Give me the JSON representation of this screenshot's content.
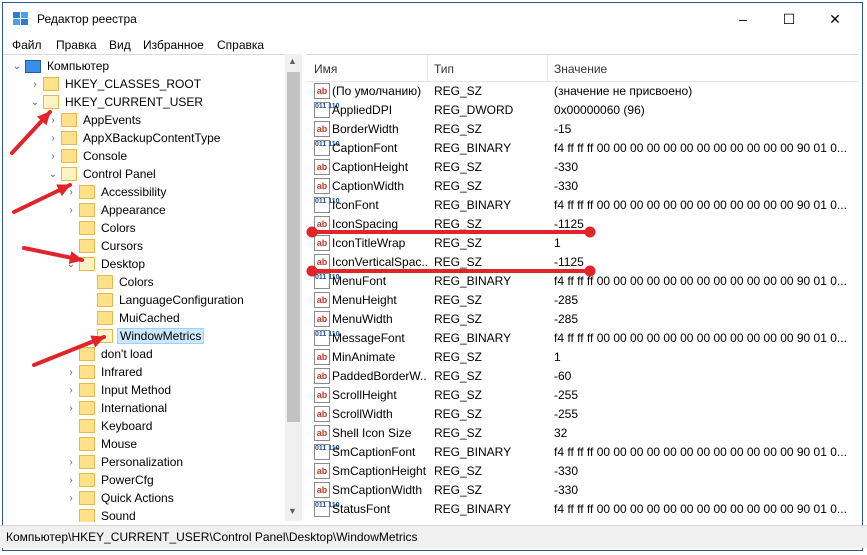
{
  "window": {
    "title": "Редактор реестра",
    "min": "–",
    "max": "☐",
    "close": "✕"
  },
  "menu": [
    "Файл",
    "Правка",
    "Вид",
    "Избранное",
    "Справка"
  ],
  "tree": [
    {
      "label": "Компьютер",
      "chev": "v",
      "level": 0,
      "kind": "computer"
    },
    {
      "label": "HKEY_CLASSES_ROOT",
      "chev": ">",
      "level": 1
    },
    {
      "label": "HKEY_CURRENT_USER",
      "chev": "v",
      "level": 1
    },
    {
      "label": "AppEvents",
      "chev": ">",
      "level": 2
    },
    {
      "label": "AppXBackupContentType",
      "chev": ">",
      "level": 2
    },
    {
      "label": "Console",
      "chev": ">",
      "level": 2
    },
    {
      "label": "Control Panel",
      "chev": "v",
      "level": 2
    },
    {
      "label": "Accessibility",
      "chev": ">",
      "level": 3
    },
    {
      "label": "Appearance",
      "chev": ">",
      "level": 3
    },
    {
      "label": "Colors",
      "chev": "",
      "level": 3
    },
    {
      "label": "Cursors",
      "chev": "",
      "level": 3
    },
    {
      "label": "Desktop",
      "chev": "v",
      "level": 3
    },
    {
      "label": "Colors",
      "chev": "",
      "level": 4
    },
    {
      "label": "LanguageConfiguration",
      "chev": "",
      "level": 4
    },
    {
      "label": "MuiCached",
      "chev": "",
      "level": 4
    },
    {
      "label": "WindowMetrics",
      "chev": "",
      "level": 4,
      "selected": true
    },
    {
      "label": "don't load",
      "chev": "",
      "level": 3
    },
    {
      "label": "Infrared",
      "chev": ">",
      "level": 3
    },
    {
      "label": "Input Method",
      "chev": ">",
      "level": 3
    },
    {
      "label": "International",
      "chev": ">",
      "level": 3
    },
    {
      "label": "Keyboard",
      "chev": "",
      "level": 3
    },
    {
      "label": "Mouse",
      "chev": "",
      "level": 3
    },
    {
      "label": "Personalization",
      "chev": ">",
      "level": 3
    },
    {
      "label": "PowerCfg",
      "chev": ">",
      "level": 3
    },
    {
      "label": "Quick Actions",
      "chev": ">",
      "level": 3
    },
    {
      "label": "Sound",
      "chev": "",
      "level": 3
    }
  ],
  "columns": {
    "name": "Имя",
    "type": "Тип",
    "value": "Значение"
  },
  "rows": [
    {
      "icon": "ab",
      "name": "(По умолчанию)",
      "type": "REG_SZ",
      "value": "(значение не присвоено)"
    },
    {
      "icon": "bin",
      "name": "AppliedDPI",
      "type": "REG_DWORD",
      "value": "0x00000060 (96)"
    },
    {
      "icon": "ab",
      "name": "BorderWidth",
      "type": "REG_SZ",
      "value": "-15"
    },
    {
      "icon": "bin",
      "name": "CaptionFont",
      "type": "REG_BINARY",
      "value": "f4 ff ff ff 00 00 00 00 00 00 00 00 00 00 00 00 90 01 0..."
    },
    {
      "icon": "ab",
      "name": "CaptionHeight",
      "type": "REG_SZ",
      "value": "-330"
    },
    {
      "icon": "ab",
      "name": "CaptionWidth",
      "type": "REG_SZ",
      "value": "-330"
    },
    {
      "icon": "bin",
      "name": "IconFont",
      "type": "REG_BINARY",
      "value": "f4 ff ff ff 00 00 00 00 00 00 00 00 00 00 00 00 90 01 0..."
    },
    {
      "icon": "ab",
      "name": "IconSpacing",
      "type": "REG_SZ",
      "value": "-1125"
    },
    {
      "icon": "ab",
      "name": "IconTitleWrap",
      "type": "REG_SZ",
      "value": "1"
    },
    {
      "icon": "ab",
      "name": "IconVerticalSpac...",
      "type": "REG_SZ",
      "value": "-1125"
    },
    {
      "icon": "bin",
      "name": "MenuFont",
      "type": "REG_BINARY",
      "value": "f4 ff ff ff 00 00 00 00 00 00 00 00 00 00 00 00 90 01 0..."
    },
    {
      "icon": "ab",
      "name": "MenuHeight",
      "type": "REG_SZ",
      "value": "-285"
    },
    {
      "icon": "ab",
      "name": "MenuWidth",
      "type": "REG_SZ",
      "value": "-285"
    },
    {
      "icon": "bin",
      "name": "MessageFont",
      "type": "REG_BINARY",
      "value": "f4 ff ff ff 00 00 00 00 00 00 00 00 00 00 00 00 90 01 0..."
    },
    {
      "icon": "ab",
      "name": "MinAnimate",
      "type": "REG_SZ",
      "value": "1"
    },
    {
      "icon": "ab",
      "name": "PaddedBorderW...",
      "type": "REG_SZ",
      "value": "-60"
    },
    {
      "icon": "ab",
      "name": "ScrollHeight",
      "type": "REG_SZ",
      "value": "-255"
    },
    {
      "icon": "ab",
      "name": "ScrollWidth",
      "type": "REG_SZ",
      "value": "-255"
    },
    {
      "icon": "ab",
      "name": "Shell Icon Size",
      "type": "REG_SZ",
      "value": "32"
    },
    {
      "icon": "bin",
      "name": "SmCaptionFont",
      "type": "REG_BINARY",
      "value": "f4 ff ff ff 00 00 00 00 00 00 00 00 00 00 00 00 90 01 0..."
    },
    {
      "icon": "ab",
      "name": "SmCaptionHeight",
      "type": "REG_SZ",
      "value": "-330"
    },
    {
      "icon": "ab",
      "name": "SmCaptionWidth",
      "type": "REG_SZ",
      "value": "-330"
    },
    {
      "icon": "bin",
      "name": "StatusFont",
      "type": "REG_BINARY",
      "value": "f4 ff ff ff 00 00 00 00 00 00 00 00 00 00 00 00 90 01 0..."
    }
  ],
  "status": "Компьютер\\HKEY_CURRENT_USER\\Control Panel\\Desktop\\WindowMetrics",
  "accent": "#e0242a",
  "icons": {
    "sz": "ab",
    "bin": "011 110"
  }
}
